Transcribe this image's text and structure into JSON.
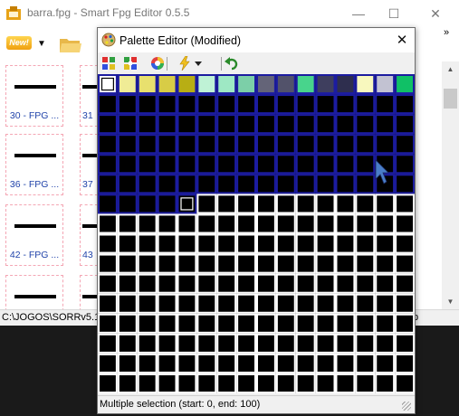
{
  "main_window": {
    "title": "barra.fpg - Smart Fpg Editor 0.5.5",
    "controls": {
      "minimize": "—",
      "maximize": "☐",
      "close": "✕"
    },
    "toolbar": {
      "new_label": "New!",
      "overflow": "»"
    },
    "gallery": {
      "items": [
        {
          "label": "30 - FPG ..."
        },
        {
          "label": "31"
        },
        {
          "label": "36 - FPG ..."
        },
        {
          "label": "37"
        },
        {
          "label": "42 - FPG ..."
        },
        {
          "label": "43"
        }
      ]
    },
    "statusbar": {
      "path": "C:\\JOGOS\\SORRv5.1",
      "right": "p"
    }
  },
  "palette_editor": {
    "title": "Palette Editor (Modified)",
    "close": "✕",
    "toolbar": {
      "icons": [
        "palette-grid-icon",
        "palette-grid-alt-icon",
        "color-wheel-icon",
        "lightning-icon",
        "dropdown-arrow-icon",
        "undo-icon"
      ]
    },
    "palette": {
      "columns": 16,
      "rows": 16,
      "selected_start": 0,
      "selected_end": 100,
      "focused_index": 100,
      "first_row_colors": [
        "#ffffff",
        "#f0ec96",
        "#e8e06e",
        "#d8cc46",
        "#b8ae14",
        "#bff2d6",
        "#9ee8c4",
        "#7ccfa8",
        "#646478",
        "#52526a",
        "#48d48c",
        "#3e3e5e",
        "#2e2e4e",
        "#f8f8be",
        "#c2c2d2",
        "#10c066"
      ],
      "other_color": "#000000",
      "selection_outline": "#1c1ca0",
      "grid_line": "#ffffff"
    },
    "status": "Multiple selection (start: 0, end: 100)"
  }
}
